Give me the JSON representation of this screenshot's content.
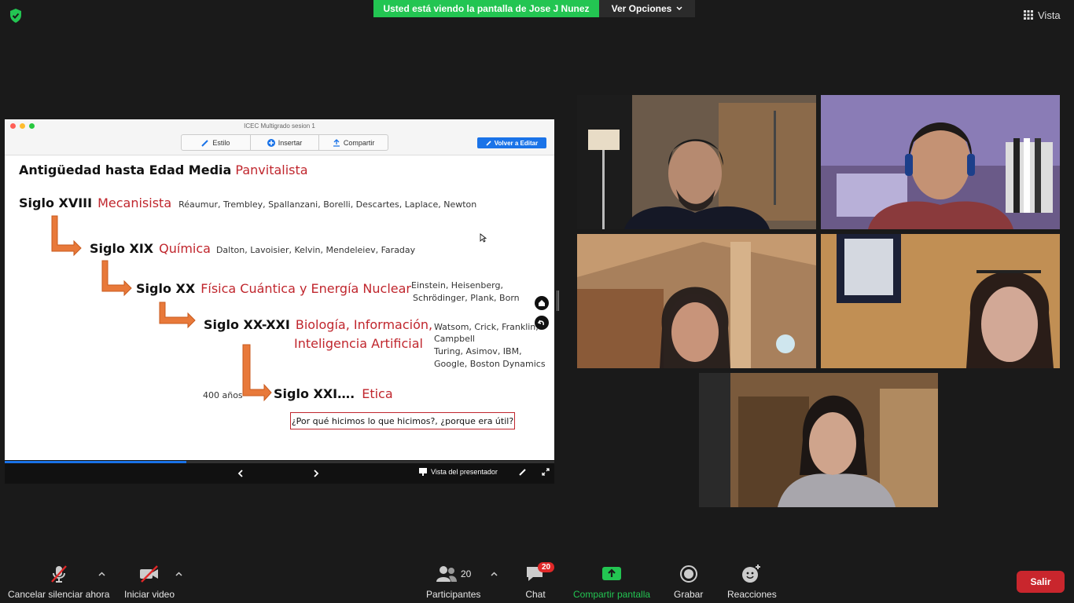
{
  "top_bar": {
    "share_banner": "Usted está viendo la pantalla de Jose J Nunez",
    "view_options": "Ver Opciones",
    "vista": "Vista"
  },
  "shared_screen": {
    "doc_title": "ICEC Multigrado sesion 1",
    "toolbar": {
      "estilo": "Estilo",
      "insertar": "Insertar",
      "compartir": "Compartir"
    },
    "edit_button": "Volver a Editar",
    "slide": {
      "line1_head": "Antigüedad hasta Edad Media",
      "line1_red": "Panvitalista",
      "line2_head": "Siglo XVIII",
      "line2_red": "Mecanisista",
      "line2_names": "Réaumur, Trembley, Spallanzani, Borelli, Descartes, Laplace, Newton",
      "line3_head": "Siglo XIX",
      "line3_red": "Química",
      "line3_names": "Dalton, Lavoisier, Kelvin, Mendeleiev, Faraday",
      "line4_head": "Siglo XX",
      "line4_red": "Física Cuántica y Energía Nuclear",
      "line4_names_1": "Einstein, Heisenberg,",
      "line4_names_2": "Schrödinger, Plank, Born",
      "line5_head": "Siglo XX-XXI",
      "line5_red_1": "Biología, Información,",
      "line5_red_2": "Inteligencia Artificial",
      "line5_names_1": "Watsom, Crick, Franklin,",
      "line5_names_2": "Campbell",
      "line5_names_3": "Turing, Asimov, IBM,",
      "line5_names_4": "Google, Boston Dynamics",
      "years": "400 años",
      "line6_head": "Siglo XXI….",
      "line6_red": "Etica",
      "quote": "¿Por qué hicimos lo que hicimos?, ¿porque era útil?"
    },
    "presenter_view": "Vista del presentador",
    "progress": 0.33
  },
  "toolbar": {
    "mute_label": "Cancelar silenciar ahora",
    "video_label": "Iniciar video",
    "participants_count": "20",
    "participants_label": "Participantes",
    "chat_badge": "20",
    "chat_label": "Chat",
    "share_label": "Compartir pantalla",
    "record_label": "Grabar",
    "reactions_label": "Reacciones",
    "leave_label": "Salir"
  },
  "colors": {
    "banner_green": "#23c552",
    "slide_red": "#c0262d",
    "arrow_orange": "#e8793a",
    "leave_red": "#c9262d"
  }
}
